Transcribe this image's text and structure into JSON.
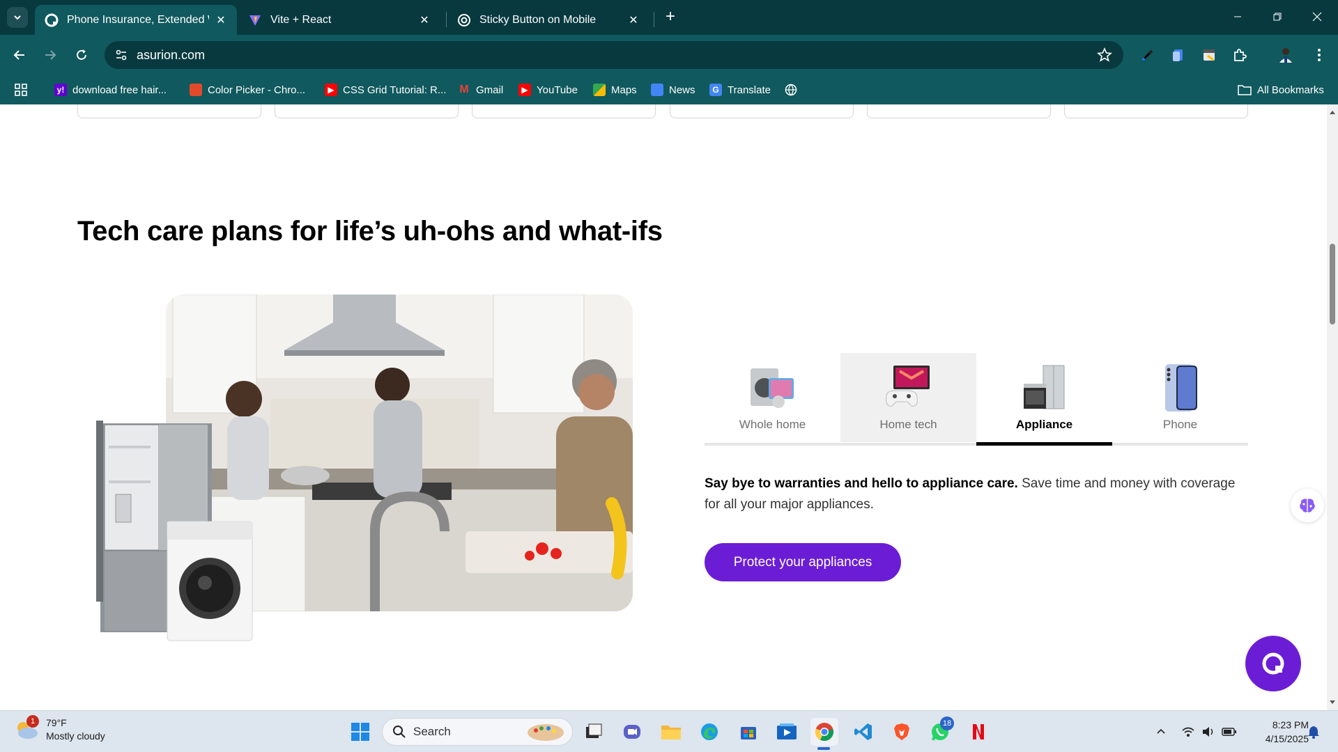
{
  "browser": {
    "tabs": [
      {
        "title": "Phone Insurance, Extended War",
        "active": true
      },
      {
        "title": "Vite + React",
        "active": false
      },
      {
        "title": "Sticky Button on Mobile",
        "active": false
      }
    ],
    "url": "asurion.com",
    "bookmarks": [
      {
        "label": "download free hair...",
        "color": "#6001d2",
        "glyph": "y!"
      },
      {
        "label": "Color Picker - Chro...",
        "color": "#e24a2b",
        "glyph": ""
      },
      {
        "label": "CSS Grid Tutorial: R...",
        "color": "#ff0000",
        "glyph": "▶"
      },
      {
        "label": "Gmail",
        "color": "#ea4335",
        "glyph": "M"
      },
      {
        "label": "YouTube",
        "color": "#ff0000",
        "glyph": "▶"
      },
      {
        "label": "Maps",
        "color": "#34a853",
        "glyph": ""
      },
      {
        "label": "News",
        "color": "#4285f4",
        "glyph": ""
      },
      {
        "label": "Translate",
        "color": "#4285f4",
        "glyph": "G"
      }
    ],
    "all_bookmarks": "All Bookmarks"
  },
  "page": {
    "heading": "Tech care plans for life’s uh-ohs and what-ifs",
    "product_tabs": [
      {
        "label": "Whole home",
        "icon": "whole-home-icon"
      },
      {
        "label": "Home tech",
        "icon": "laptop-gamepad-icon"
      },
      {
        "label": "Appliance",
        "icon": "fridge-oven-icon"
      },
      {
        "label": "Phone",
        "icon": "phone-icon"
      }
    ],
    "selected_tab": "Appliance",
    "description_bold": "Say bye to warranties and hello to appliance care.",
    "description_rest": " Save time and money with coverage for all your major appliances.",
    "cta_label": "Protect your appliances"
  },
  "taskbar": {
    "weather_temp": "79°F",
    "weather_desc": "Mostly cloudy",
    "weather_badge": "1",
    "search_label": "Search",
    "whatsapp_badge": "18",
    "time": "8:23 PM",
    "date": "4/15/2025"
  },
  "colors": {
    "chrome_dark": "#07393f",
    "chrome": "#10595e",
    "brand_purple": "#6b1dd5"
  }
}
